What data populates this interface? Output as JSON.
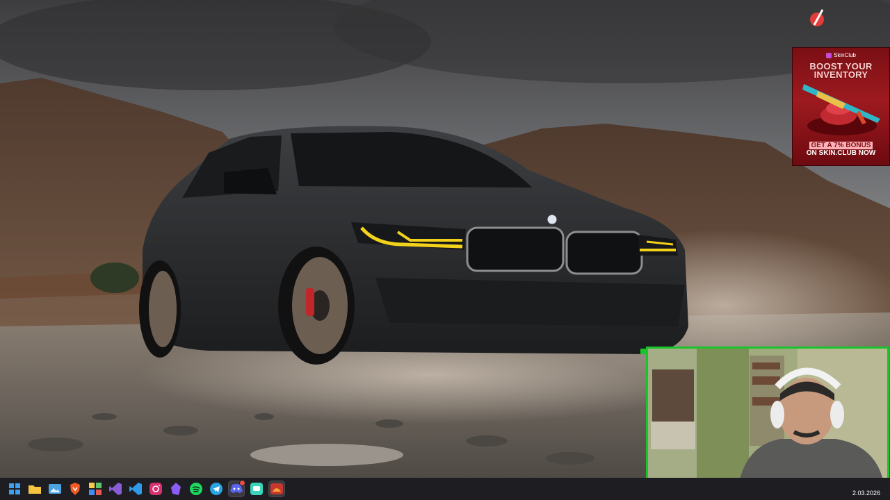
{
  "desktop": {
    "wallpaper_subject": "bmw-m5-cs-wallpaper"
  },
  "ad": {
    "brand": "SkinClub",
    "headline_line1": "BOOST YOUR",
    "headline_line2": "INVENTORY",
    "cta_line1": "GET A 7% BONUS",
    "cta_line2": "ON SKIN.CLUB NOW",
    "accent_color": "#9d1a1f"
  },
  "webcam": {
    "border_color": "#19c52b"
  },
  "taskbar": {
    "date": "2.03.2026",
    "apps": [
      {
        "name": "start-icon"
      },
      {
        "name": "file-explorer-icon"
      },
      {
        "name": "photos-icon"
      },
      {
        "name": "brave-browser-icon"
      },
      {
        "name": "code-editor-icon"
      },
      {
        "name": "visual-studio-icon"
      },
      {
        "name": "vscode-icon"
      },
      {
        "name": "instagram-icon"
      },
      {
        "name": "obsidian-icon"
      },
      {
        "name": "spotify-icon"
      },
      {
        "name": "telegram-icon"
      },
      {
        "name": "discord-icon"
      },
      {
        "name": "chat-app-icon"
      },
      {
        "name": "obs-studio-icon"
      }
    ]
  }
}
